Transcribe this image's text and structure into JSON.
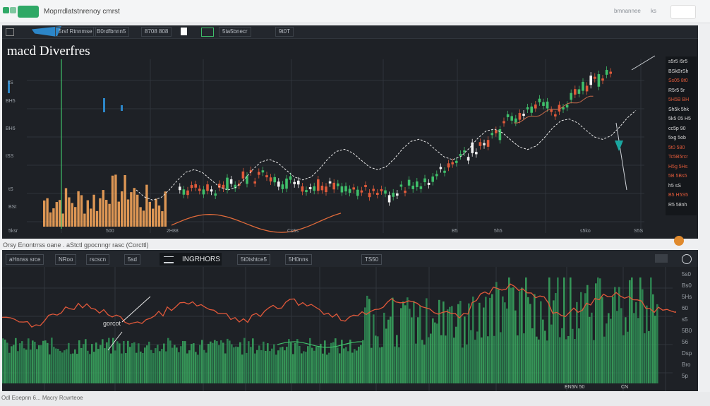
{
  "window": {
    "tab_label": "",
    "title": "Moprrdlatstnrenoy cmrst",
    "right_text": "bmnannee",
    "right_badge": "ks"
  },
  "panel1": {
    "toolbar": [
      "5rsf Rtnnmse",
      "B0rdfbnnn5",
      "8708 808",
      "5ta5bnecr",
      "9t0T"
    ],
    "title": "macd Diverfres",
    "left_labels": [
      "tS",
      "BH5",
      "BH6",
      "tSS",
      "tS",
      "BSt"
    ],
    "bottom_labels": [
      "5ksr",
      "500",
      "2H88",
      "Cs5s",
      "B5",
      "5h5",
      "s5ko",
      "S5S"
    ],
    "right_labels": [
      {
        "t": "s5r5 i5r5",
        "c": "#d8d8d8"
      },
      {
        "t": "BSkBrSh",
        "c": "#d8d8d8"
      },
      {
        "t": "Ss05 8t0",
        "c": "#e05a3a"
      },
      {
        "t": "R5r5 5r",
        "c": "#d8d8d8"
      },
      {
        "t": "5H5B BH",
        "c": "#e05a3a"
      },
      {
        "t": "Sh5k 5hk",
        "c": "#d8d8d8"
      },
      {
        "t": "5k5 05 H5",
        "c": "#d8d8d8"
      },
      {
        "t": "cc5p 90",
        "c": "#d8d8d8"
      },
      {
        "t": "5xg 5ob",
        "c": "#d8d8d8"
      },
      {
        "t": "5t0 580",
        "c": "#e05a3a"
      },
      {
        "t": "Tc5B5rcr",
        "c": "#e05a3a"
      },
      {
        "t": "H5g 5Hs",
        "c": "#e05a3a"
      },
      {
        "t": "5B 5Bs5",
        "c": "#e05a3a"
      },
      {
        "t": "h5 sS",
        "c": "#d8d8d8"
      },
      {
        "t": "B5 H5S5",
        "c": "#e05a3a"
      },
      {
        "t": "R5 58nh",
        "c": "#d8d8d8"
      }
    ]
  },
  "caption": "Orsy Enontrrss oane . aStctl gpocnngr rasc (Corcttl)",
  "panel2": {
    "toolbar": [
      "aHnnss srce",
      "NRoo",
      "rscscn",
      "5sd",
      "INGRHORS",
      "5t0tshtce5",
      "5H0nns",
      "TS50"
    ],
    "annotation": "gorcot",
    "right_labels": [
      "5s0",
      "Bs0",
      "5Hs",
      "60",
      "s5",
      "5B0",
      "56",
      "Dsp",
      "Bro",
      "5p"
    ],
    "bottom_labels": [
      "EN5N 50",
      "CN"
    ]
  },
  "footer": {
    "text": "Odl Eoepnn 6...   Macry Rcwrteoe"
  },
  "colors": {
    "up": "#3fbf6a",
    "down": "#e05a3a",
    "volume": "#f2a35a",
    "background": "#1e2126"
  }
}
